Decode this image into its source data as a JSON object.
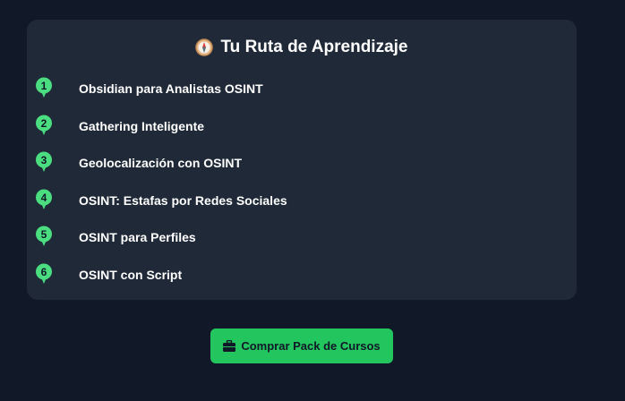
{
  "route": {
    "title": "Tu Ruta de Aprendizaje",
    "title_icon": "compass-icon",
    "steps": [
      {
        "number": "1",
        "label": "Obsidian para Analistas OSINT"
      },
      {
        "number": "2",
        "label": "Gathering Inteligente"
      },
      {
        "number": "3",
        "label": "Geolocalización con OSINT"
      },
      {
        "number": "4",
        "label": "OSINT: Estafas por Redes Sociales"
      },
      {
        "number": "5",
        "label": "OSINT para Perfiles"
      },
      {
        "number": "6",
        "label": "OSINT con Script"
      }
    ]
  },
  "cta": {
    "label": "Comprar Pack de Cursos",
    "icon": "briefcase-icon"
  },
  "colors": {
    "background": "#111827",
    "card": "#1f2937",
    "accent": "#22c55e",
    "marker": "#4ade80"
  }
}
